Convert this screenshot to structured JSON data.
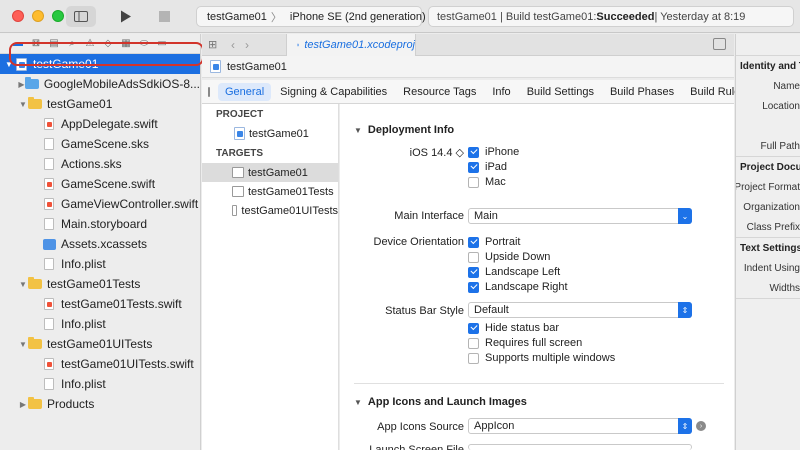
{
  "toolbar": {
    "scheme_name": "testGame01",
    "destination": "iPhone SE (2nd generation)",
    "status_prefix": "testGame01 | Build testGame01: ",
    "status_result": "Succeeded",
    "status_time": " | Yesterday at 8:19"
  },
  "navigator": {
    "rows": [
      {
        "label": "testGame01",
        "type": "project",
        "indent": 0,
        "disclosure": "▼",
        "selected": true
      },
      {
        "label": "GoogleMobileAdsSdkiOS-8...",
        "type": "folder-blue",
        "indent": 1,
        "disclosure": "▶"
      },
      {
        "label": "testGame01",
        "type": "folder",
        "indent": 1,
        "disclosure": "▼"
      },
      {
        "label": "AppDelegate.swift",
        "type": "swift",
        "indent": 2
      },
      {
        "label": "GameScene.sks",
        "type": "file",
        "indent": 2
      },
      {
        "label": "Actions.sks",
        "type": "file",
        "indent": 2
      },
      {
        "label": "GameScene.swift",
        "type": "swift",
        "indent": 2
      },
      {
        "label": "GameViewController.swift",
        "type": "swift",
        "indent": 2
      },
      {
        "label": "Main.storyboard",
        "type": "file",
        "indent": 2
      },
      {
        "label": "Assets.xcassets",
        "type": "assets",
        "indent": 2
      },
      {
        "label": "Info.plist",
        "type": "file",
        "indent": 2
      },
      {
        "label": "testGame01Tests",
        "type": "folder",
        "indent": 1,
        "disclosure": "▼"
      },
      {
        "label": "testGame01Tests.swift",
        "type": "swift",
        "indent": 2
      },
      {
        "label": "Info.plist",
        "type": "file",
        "indent": 2
      },
      {
        "label": "testGame01UITests",
        "type": "folder",
        "indent": 1,
        "disclosure": "▼"
      },
      {
        "label": "testGame01UITests.swift",
        "type": "swift",
        "indent": 2
      },
      {
        "label": "Info.plist",
        "type": "file",
        "indent": 2
      },
      {
        "label": "Products",
        "type": "folder",
        "indent": 1,
        "disclosure": "▶"
      }
    ]
  },
  "editor": {
    "tab_file": "testGame01.xcodeproj",
    "project_name": "testGame01",
    "tabs": [
      "General",
      "Signing & Capabilities",
      "Resource Tags",
      "Info",
      "Build Settings",
      "Build Phases",
      "Build Rules"
    ],
    "active_tab": 0
  },
  "targets": {
    "project_header": "PROJECT",
    "project_item": "testGame01",
    "targets_header": "TARGETS",
    "items": [
      "testGame01",
      "testGame01Tests",
      "testGame01UITests"
    ],
    "selected": 0
  },
  "deployment": {
    "title": "Deployment Info",
    "ios_version": "iOS 14.4 ◇",
    "devices": [
      {
        "label": "iPhone",
        "checked": true
      },
      {
        "label": "iPad",
        "checked": true
      },
      {
        "label": "Mac",
        "checked": false
      }
    ],
    "main_interface_label": "Main Interface",
    "main_interface_value": "Main",
    "orientation_label": "Device Orientation",
    "orientations": [
      {
        "label": "Portrait",
        "checked": true
      },
      {
        "label": "Upside Down",
        "checked": false
      },
      {
        "label": "Landscape Left",
        "checked": true
      },
      {
        "label": "Landscape Right",
        "checked": true
      }
    ],
    "status_bar_label": "Status Bar Style",
    "status_bar_value": "Default",
    "status_options": [
      {
        "label": "Hide status bar",
        "checked": true
      },
      {
        "label": "Requires full screen",
        "checked": false
      },
      {
        "label": "Supports multiple windows",
        "checked": false
      }
    ]
  },
  "app_icons": {
    "title": "App Icons and Launch Images",
    "source_label": "App Icons Source",
    "source_value": "AppIcon",
    "launch_label": "Launch Screen File"
  },
  "inspector": {
    "sections": [
      {
        "title": "Identity and Type",
        "labels": [
          "Name",
          "Location",
          "",
          "Full Path"
        ]
      },
      {
        "title": "Project Document",
        "labels": [
          "Project Format",
          "Organization",
          "Class Prefix"
        ]
      },
      {
        "title": "Text Settings",
        "labels": [
          "Indent Using",
          "Widths"
        ]
      }
    ]
  }
}
